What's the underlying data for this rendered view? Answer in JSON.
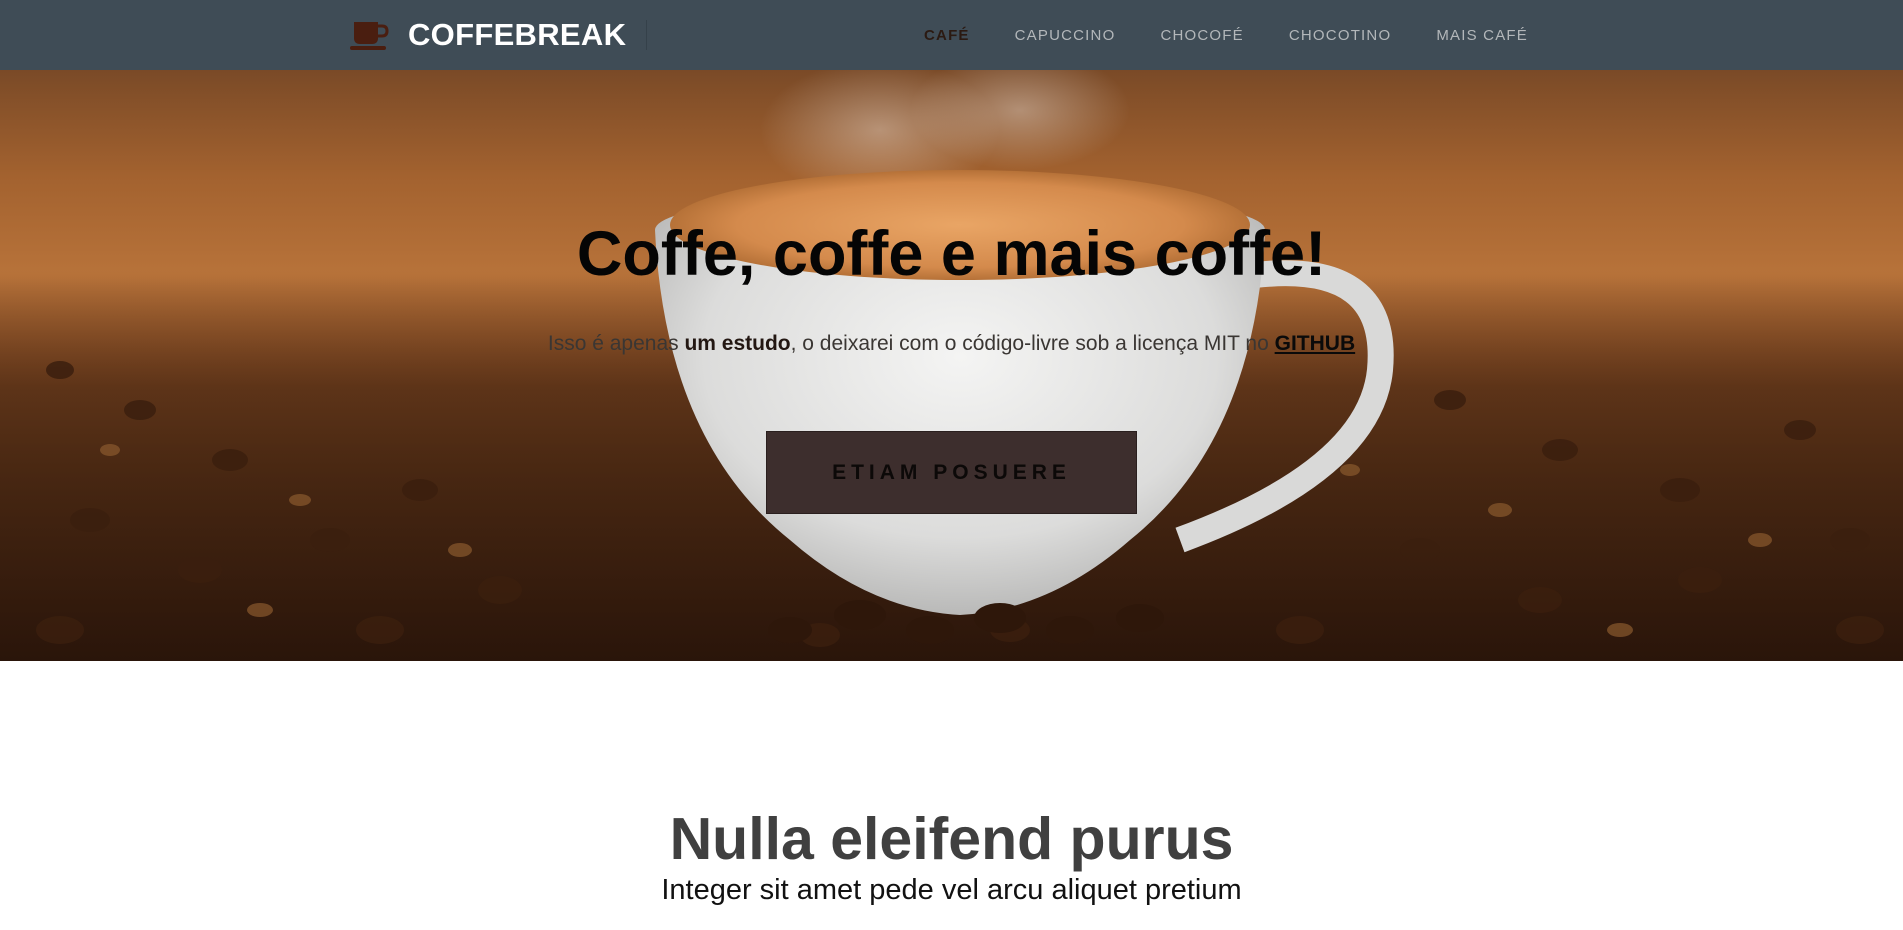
{
  "navbar": {
    "brand": "COFFEBREAK",
    "brand_icon": "coffee-cup-icon",
    "items": [
      {
        "label": "CAFÉ",
        "active": true
      },
      {
        "label": "CAPUCCINO",
        "active": false
      },
      {
        "label": "CHOCOFÉ",
        "active": false
      },
      {
        "label": "CHOCOTINO",
        "active": false
      },
      {
        "label": "MAIS CAFÉ",
        "active": false
      }
    ]
  },
  "hero": {
    "title": "Coffe, coffe e mais coffe!",
    "subtitle_pre": "Isso é apenas ",
    "subtitle_bold": "um estudo",
    "subtitle_mid": ", o deixarei com o código-livre sob a licença MIT no ",
    "subtitle_link": "GITHUB",
    "button_label": "ETIAM POSUERE",
    "background_image": "coffee-cup-on-beans"
  },
  "section": {
    "title": "Nulla eleifend purus",
    "subtitle": "Integer sit amet pede vel arcu aliquet pretium"
  },
  "colors": {
    "navbar_bg": "#3f4c56",
    "brand_text": "#ffffff",
    "nav_text": "#b3b7ba",
    "nav_active": "#2b1a12",
    "button_bg": "#3d2e2d",
    "section_title": "#404040"
  }
}
